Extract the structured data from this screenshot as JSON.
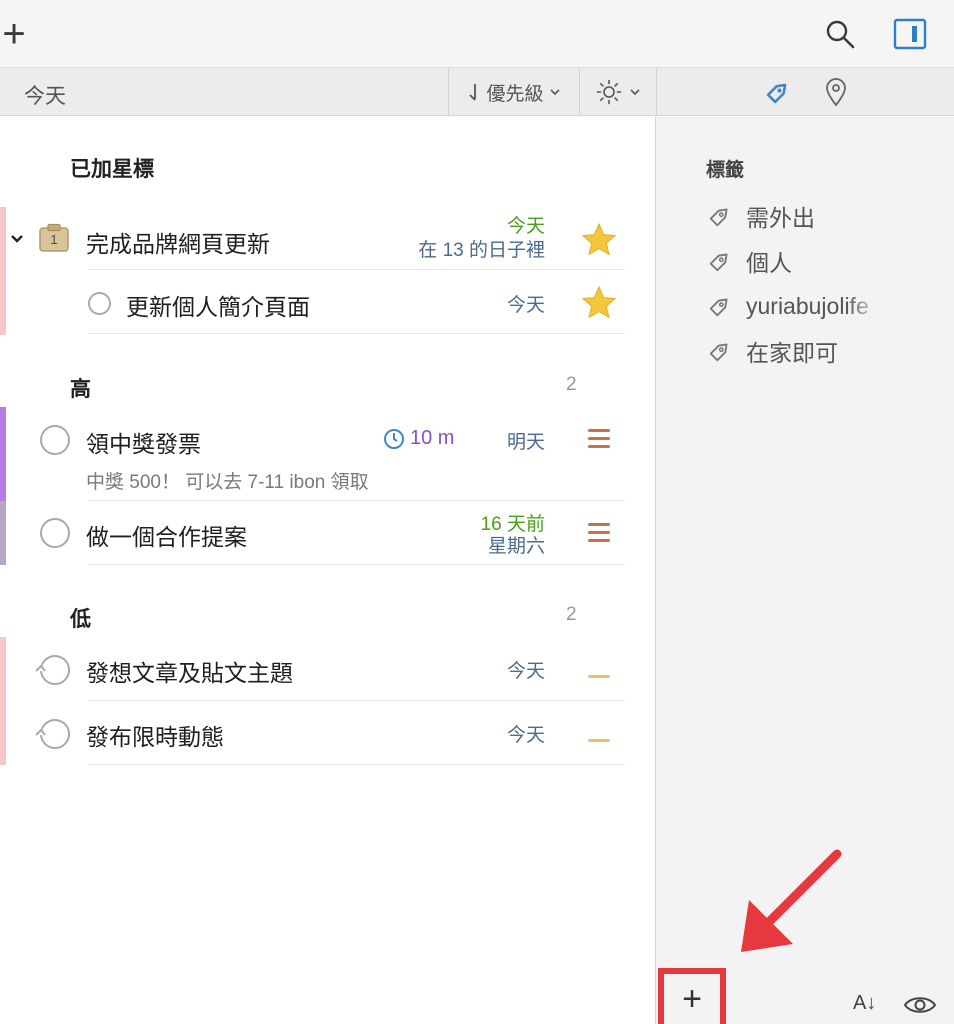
{
  "toolbar": {
    "add_icon": "plus-icon",
    "search_icon": "search-icon",
    "sidebar_icon": "sidebar-toggle-icon"
  },
  "header": {
    "title": "今天",
    "sort_label": "優先級",
    "display_icon": "sun-icon",
    "side_tabs": [
      "tag-icon",
      "location-pin-icon"
    ]
  },
  "sections": {
    "starred": {
      "title": "已加星標",
      "project": {
        "title": "完成品牌網頁更新",
        "badge": "1",
        "date_line1": "今天",
        "date_line2": "在 13 的日子裡"
      },
      "subtask": {
        "title": "更新個人簡介頁面",
        "date": "今天"
      }
    },
    "high": {
      "title": "高",
      "count": "2",
      "tasks": [
        {
          "title": "領中獎發票",
          "duration": "10 m",
          "date": "明天",
          "note": "中獎 500！ 可以去 7-11 ibon 領取"
        },
        {
          "title": "做一個合作提案",
          "date_line1": "16 天前",
          "date_line2": "星期六"
        }
      ]
    },
    "low": {
      "title": "低",
      "count": "2",
      "tasks": [
        {
          "title": "發想文章及貼文主題",
          "date": "今天"
        },
        {
          "title": "發布限時動態",
          "date": "今天"
        }
      ]
    }
  },
  "sidebar": {
    "tags_title": "標籤",
    "tags": [
      "需外出",
      "個人",
      "yuriabujolife",
      "在家即可"
    ]
  },
  "footer": {
    "add_label": "+",
    "sort_label": "A↓",
    "eye_icon": "eye-icon"
  },
  "colors": {
    "accent_blue": "#3f88c5",
    "date_green": "#4a9e1c",
    "date_blue": "#4c6a8e",
    "high_priority": "#c9704b",
    "low_priority": "#e9c265",
    "star": "#f3c73b",
    "highlight_red": "#e5393f"
  }
}
